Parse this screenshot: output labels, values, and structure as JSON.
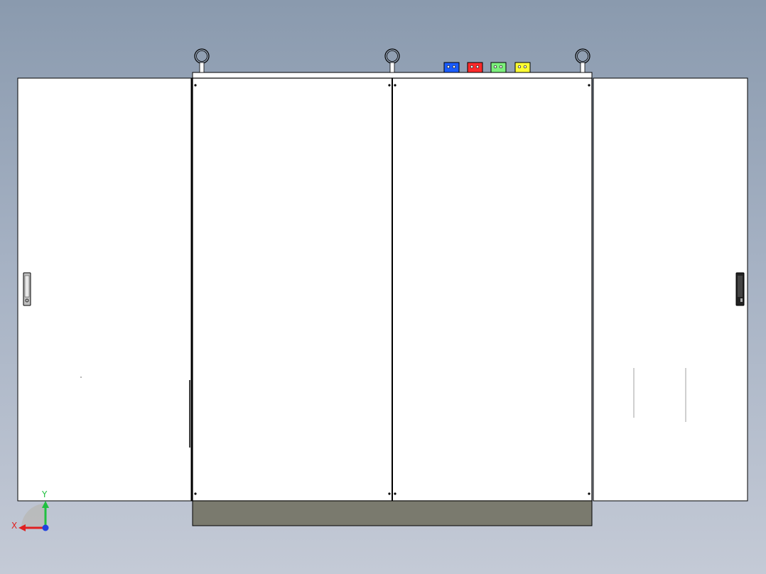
{
  "viewport": {
    "background_top": "#8a9aae",
    "background_bottom": "#c4cad6"
  },
  "model": {
    "panel_fill": "#ffffff",
    "edge_color": "#000000",
    "plinth_fill": "#7a7a6e"
  },
  "top_blocks": [
    {
      "name": "blue-terminal",
      "color": "#1a5cff"
    },
    {
      "name": "red-terminal",
      "color": "#ff2a2a"
    },
    {
      "name": "green-terminal",
      "color": "#7cf07c"
    },
    {
      "name": "yellow-terminal",
      "color": "#ffff33"
    }
  ],
  "triad": {
    "x_label": "X",
    "y_label": "Y",
    "x_color": "#e02020",
    "y_color": "#20c040",
    "z_color": "#2040e0"
  }
}
